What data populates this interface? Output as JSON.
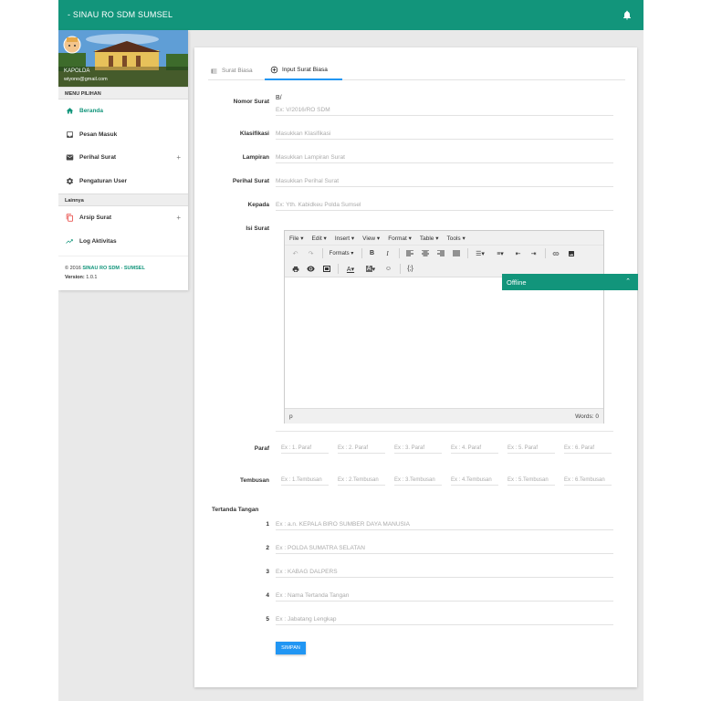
{
  "header": {
    "title": "- SINAU RO SDM SUMSEL",
    "icon": "bell-icon"
  },
  "sidebar": {
    "user_name": "KAPOLDA",
    "user_email": "wiyono@gmail.com",
    "menu_header": "MENU PILIHAN",
    "items": [
      {
        "label": "Beranda",
        "icon": "home-icon",
        "active": true
      },
      {
        "label": "Pesan Masuk",
        "icon": "inbox-icon"
      },
      {
        "label": "Perihal Surat",
        "icon": "mail-icon",
        "expand": "+"
      },
      {
        "label": "Pengaturan User",
        "icon": "gear-icon"
      }
    ],
    "section2": "Lainnya",
    "items2": [
      {
        "label": "Arsip Surat",
        "icon": "copy-icon",
        "expand": "+"
      },
      {
        "label": "Log Aktivitas",
        "icon": "trending-icon"
      }
    ],
    "copyright_prefix": "© 2016",
    "copyright_brand": "SINAU RO SDM - SUMSEL",
    "version_label": "Version:",
    "version_value": "1.0.1"
  },
  "tabs": [
    {
      "label": "Surat Biasa",
      "icon": "list-icon"
    },
    {
      "label": "Input Surat Biasa",
      "icon": "plus-circle-icon",
      "active": true
    }
  ],
  "form": {
    "nomor_label": "Nomor Surat",
    "nomor_prefix": "B/",
    "nomor_placeholder": "Ex: V/2016/RO SDM",
    "klasifikasi_label": "Klasifikasi",
    "klasifikasi_placeholder": "Masukkan Klasifikasi",
    "lampiran_label": "Lampiran",
    "lampiran_placeholder": "Masukkan Lampiran Surat",
    "perihal_label": "Perihal Surat",
    "perihal_placeholder": "Masukkan Perihal Surat",
    "kepada_label": "Kepada",
    "kepada_placeholder": "Ex: Yth. Kabidkeu Polda Sumsel",
    "isi_label": "Isi Surat",
    "paraf_label": "Paraf",
    "paraf": [
      "Ex : 1. Paraf",
      "Ex : 2. Paraf",
      "Ex : 3. Paraf",
      "Ex : 4. Paraf",
      "Ex : 5. Paraf",
      "Ex : 6. Paraf"
    ],
    "tembusan_label": "Tembusan",
    "tembusan": [
      "Ex : 1.Tembusan",
      "Ex : 2.Tembusan",
      "Ex : 3.Tembusan",
      "Ex : 4.Tembusan",
      "Ex : 5.Tembusan",
      "Ex : 6.Tembusan"
    ],
    "tertanda_label": "Tertanda Tangan",
    "tertanda": [
      {
        "num": "1",
        "placeholder": "Ex : a.n. KEPALA BIRO SUMBER DAYA MANUSIA"
      },
      {
        "num": "2",
        "placeholder": "Ex : POLDA SUMATRA SELATAN"
      },
      {
        "num": "3",
        "placeholder": "Ex : KABAG DALPERS"
      },
      {
        "num": "4",
        "placeholder": "Ex : Nama Tertanda Tangan"
      },
      {
        "num": "5",
        "placeholder": "Ex : Jabatang Lengkap"
      }
    ],
    "submit_label": "SIMPAN"
  },
  "editor": {
    "menus": [
      "File ▾",
      "Edit ▾",
      "Insert ▾",
      "View ▾",
      "Format ▾",
      "Table ▾",
      "Tools ▾"
    ],
    "formats_label": "Formats ▾",
    "status_path": "p",
    "word_count": "Words: 0"
  },
  "chat": {
    "status": "Offline",
    "toggle": "⌃"
  },
  "colors": {
    "primary": "#12957b",
    "accent": "#2196f3"
  }
}
